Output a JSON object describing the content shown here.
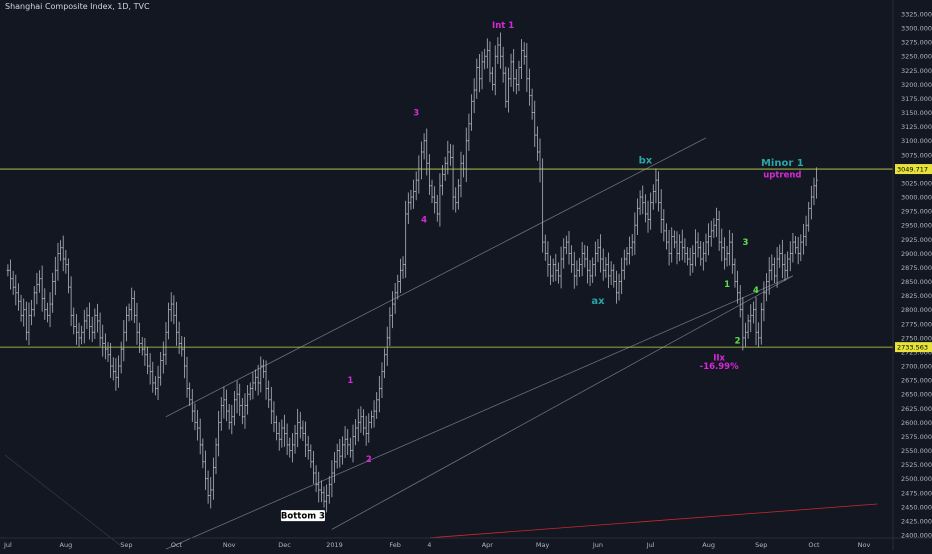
{
  "title": "Shanghai Composite Index, 1D, TVC",
  "chart_data": {
    "type": "ohlc",
    "colors": {
      "background": "#131722",
      "bars": "#b2b5be",
      "channel": "#6b6e78",
      "hline": "#c6d94a",
      "trend": "#c9282d",
      "magenta": "#d62ad6",
      "green": "#5ee04a",
      "teal": "#2aa5a5"
    },
    "y_axis": {
      "ylim": [
        2400,
        3325
      ],
      "ticks": [
        2400,
        2425,
        2450,
        2475,
        2500,
        2525,
        2550,
        2575,
        2600,
        2625,
        2650,
        2675,
        2700,
        2725,
        2750,
        2775,
        2800,
        2825,
        2850,
        2875,
        2900,
        2925,
        2950,
        2975,
        3000,
        3025,
        3050,
        3075,
        3100,
        3125,
        3150,
        3175,
        3200,
        3225,
        3250,
        3275,
        3300,
        3325
      ]
    },
    "x_ticks": [
      {
        "label": "Jul",
        "t": 0
      },
      {
        "label": "Aug",
        "t": 22
      },
      {
        "label": "Sep",
        "t": 45
      },
      {
        "label": "Oct",
        "t": 64
      },
      {
        "label": "Nov",
        "t": 84
      },
      {
        "label": "Dec",
        "t": 105
      },
      {
        "label": "2019",
        "t": 124
      },
      {
        "label": "Feb",
        "t": 147
      },
      {
        "label": "4",
        "t": 160
      },
      {
        "label": "Apr",
        "t": 182
      },
      {
        "label": "May",
        "t": 203
      },
      {
        "label": "Jun",
        "t": 224
      },
      {
        "label": "Jul",
        "t": 244
      },
      {
        "label": "Aug",
        "t": 266
      },
      {
        "label": "Sep",
        "t": 286
      },
      {
        "label": "Oct",
        "t": 306
      },
      {
        "label": "Nov",
        "t": 325
      }
    ],
    "price_labels": [
      {
        "value": 3049.717,
        "text": "3049.717",
        "color": "#e8e33a",
        "textColor": "#000000"
      },
      {
        "value": 2733.563,
        "text": "2733.563",
        "color": "#e8e33a",
        "textColor": "#000000"
      }
    ],
    "hlines": [
      3049.717,
      2733.563
    ],
    "closes": [
      2870,
      2855,
      2840,
      2830,
      2815,
      2790,
      2800,
      2760,
      2790,
      2800,
      2830,
      2845,
      2855,
      2820,
      2800,
      2790,
      2810,
      2850,
      2870,
      2900,
      2910,
      2890,
      2880,
      2840,
      2790,
      2770,
      2760,
      2750,
      2760,
      2780,
      2790,
      2770,
      2760,
      2790,
      2780,
      2750,
      2740,
      2730,
      2720,
      2700,
      2690,
      2680,
      2700,
      2730,
      2760,
      2790,
      2800,
      2820,
      2790,
      2760,
      2740,
      2730,
      2720,
      2700,
      2690,
      2670,
      2660,
      2680,
      2710,
      2720,
      2760,
      2800,
      2810,
      2790,
      2760,
      2740,
      2730,
      2700,
      2660,
      2640,
      2620,
      2600,
      2590,
      2560,
      2530,
      2500,
      2470,
      2480,
      2520,
      2560,
      2600,
      2630,
      2640,
      2620,
      2600,
      2610,
      2640,
      2650,
      2630,
      2610,
      2630,
      2650,
      2660,
      2670,
      2680,
      2670,
      2700,
      2690,
      2660,
      2640,
      2620,
      2600,
      2580,
      2570,
      2590,
      2580,
      2560,
      2550,
      2560,
      2580,
      2600,
      2590,
      2580,
      2560,
      2550,
      2530,
      2510,
      2490,
      2480,
      2475,
      2460,
      2470,
      2490,
      2510,
      2530,
      2550,
      2540,
      2560,
      2570,
      2560,
      2550,
      2575,
      2590,
      2600,
      2610,
      2590,
      2580,
      2600,
      2610,
      2620,
      2640,
      2660,
      2690,
      2720,
      2750,
      2790,
      2810,
      2830,
      2850,
      2870,
      2880,
      2970,
      2990,
      3000,
      3010,
      3030,
      3050,
      3080,
      3100,
      3060,
      3020,
      3000,
      2990,
      2970,
      3020,
      3040,
      3060,
      3080,
      3070,
      3000,
      2990,
      3020,
      3060,
      3050,
      3100,
      3130,
      3170,
      3190,
      3230,
      3210,
      3240,
      3250,
      3260,
      3220,
      3200,
      3250,
      3270,
      3250,
      3220,
      3170,
      3210,
      3240,
      3210,
      3200,
      3230,
      3260,
      3250,
      3210,
      3180,
      3150,
      3110,
      3080,
      3050,
      2920,
      2900,
      2880,
      2860,
      2880,
      2870,
      2860,
      2890,
      2910,
      2920,
      2900,
      2880,
      2860,
      2870,
      2880,
      2900,
      2890,
      2870,
      2860,
      2880,
      2900,
      2910,
      2890,
      2870,
      2880,
      2860,
      2870,
      2850,
      2830,
      2850,
      2870,
      2890,
      2900,
      2910,
      2920,
      2950,
      2980,
      3000,
      2990,
      2970,
      2960,
      2990,
      3010,
      3030,
      2990,
      2960,
      2940,
      2920,
      2900,
      2930,
      2920,
      2900,
      2920,
      2910,
      2900,
      2890,
      2880,
      2900,
      2920,
      2910,
      2890,
      2900,
      2920,
      2930,
      2940,
      2950,
      2960,
      2920,
      2910,
      2890,
      2900,
      2920,
      2880,
      2850,
      2830,
      2800,
      2750,
      2760,
      2780,
      2790,
      2800,
      2760,
      2750,
      2800,
      2830,
      2850,
      2870,
      2880,
      2860,
      2890,
      2900,
      2880,
      2870,
      2890,
      2900,
      2920,
      2910,
      2900,
      2920,
      2930,
      2950,
      2980,
      3000,
      3020,
      3030
    ]
  },
  "annotations": [
    {
      "text": "Int 1",
      "color": "#d62ad6",
      "t": 188,
      "value": 3300
    },
    {
      "text": "3",
      "color": "#d62ad6",
      "t": 155,
      "value": 3145
    },
    {
      "text": "4",
      "color": "#d62ad6",
      "t": 158,
      "value": 2955
    },
    {
      "text": "1",
      "color": "#d62ad6",
      "t": 130,
      "value": 2670
    },
    {
      "text": "2",
      "color": "#d62ad6",
      "t": 137,
      "value": 2530
    },
    {
      "text": "Bottom 3",
      "color": "#ffffff",
      "t": 112,
      "value": 2430,
      "boxed": true
    },
    {
      "text": "bx",
      "color": "#2aa5a5",
      "t": 242,
      "value": 3060
    },
    {
      "text": "ax",
      "color": "#2aa5a5",
      "t": 224,
      "value": 2810
    },
    {
      "text": "Minor 1",
      "color": "#2aa5a5",
      "t": 294,
      "value": 3055
    },
    {
      "text": "uptrend",
      "color": "#d62ad6",
      "t": 294,
      "value": 3035
    },
    {
      "text": "IIx",
      "color": "#d62ad6",
      "t": 270,
      "value": 2710
    },
    {
      "text": "-16.99%",
      "color": "#d62ad6",
      "t": 270,
      "value": 2695
    },
    {
      "text": "1",
      "color": "#5ee04a",
      "t": 273,
      "value": 2840
    },
    {
      "text": "2",
      "color": "#5ee04a",
      "t": 277,
      "value": 2740
    },
    {
      "text": "3",
      "color": "#5ee04a",
      "t": 280,
      "value": 2915
    },
    {
      "text": "4",
      "color": "#5ee04a",
      "t": 284,
      "value": 2830
    }
  ],
  "channels": [
    {
      "t1": 60,
      "v1": 2610,
      "t2": 265,
      "v2": 3105
    },
    {
      "t1": 60,
      "v1": 2375,
      "t2": 298,
      "v2": 2860
    },
    {
      "t1": 123,
      "v1": 2410,
      "t2": 298,
      "v2": 2860
    }
  ],
  "trendlines": [
    {
      "t1": 160,
      "v1": 2395,
      "t2": 330,
      "v2": 2455,
      "color": "#c9282d"
    }
  ]
}
